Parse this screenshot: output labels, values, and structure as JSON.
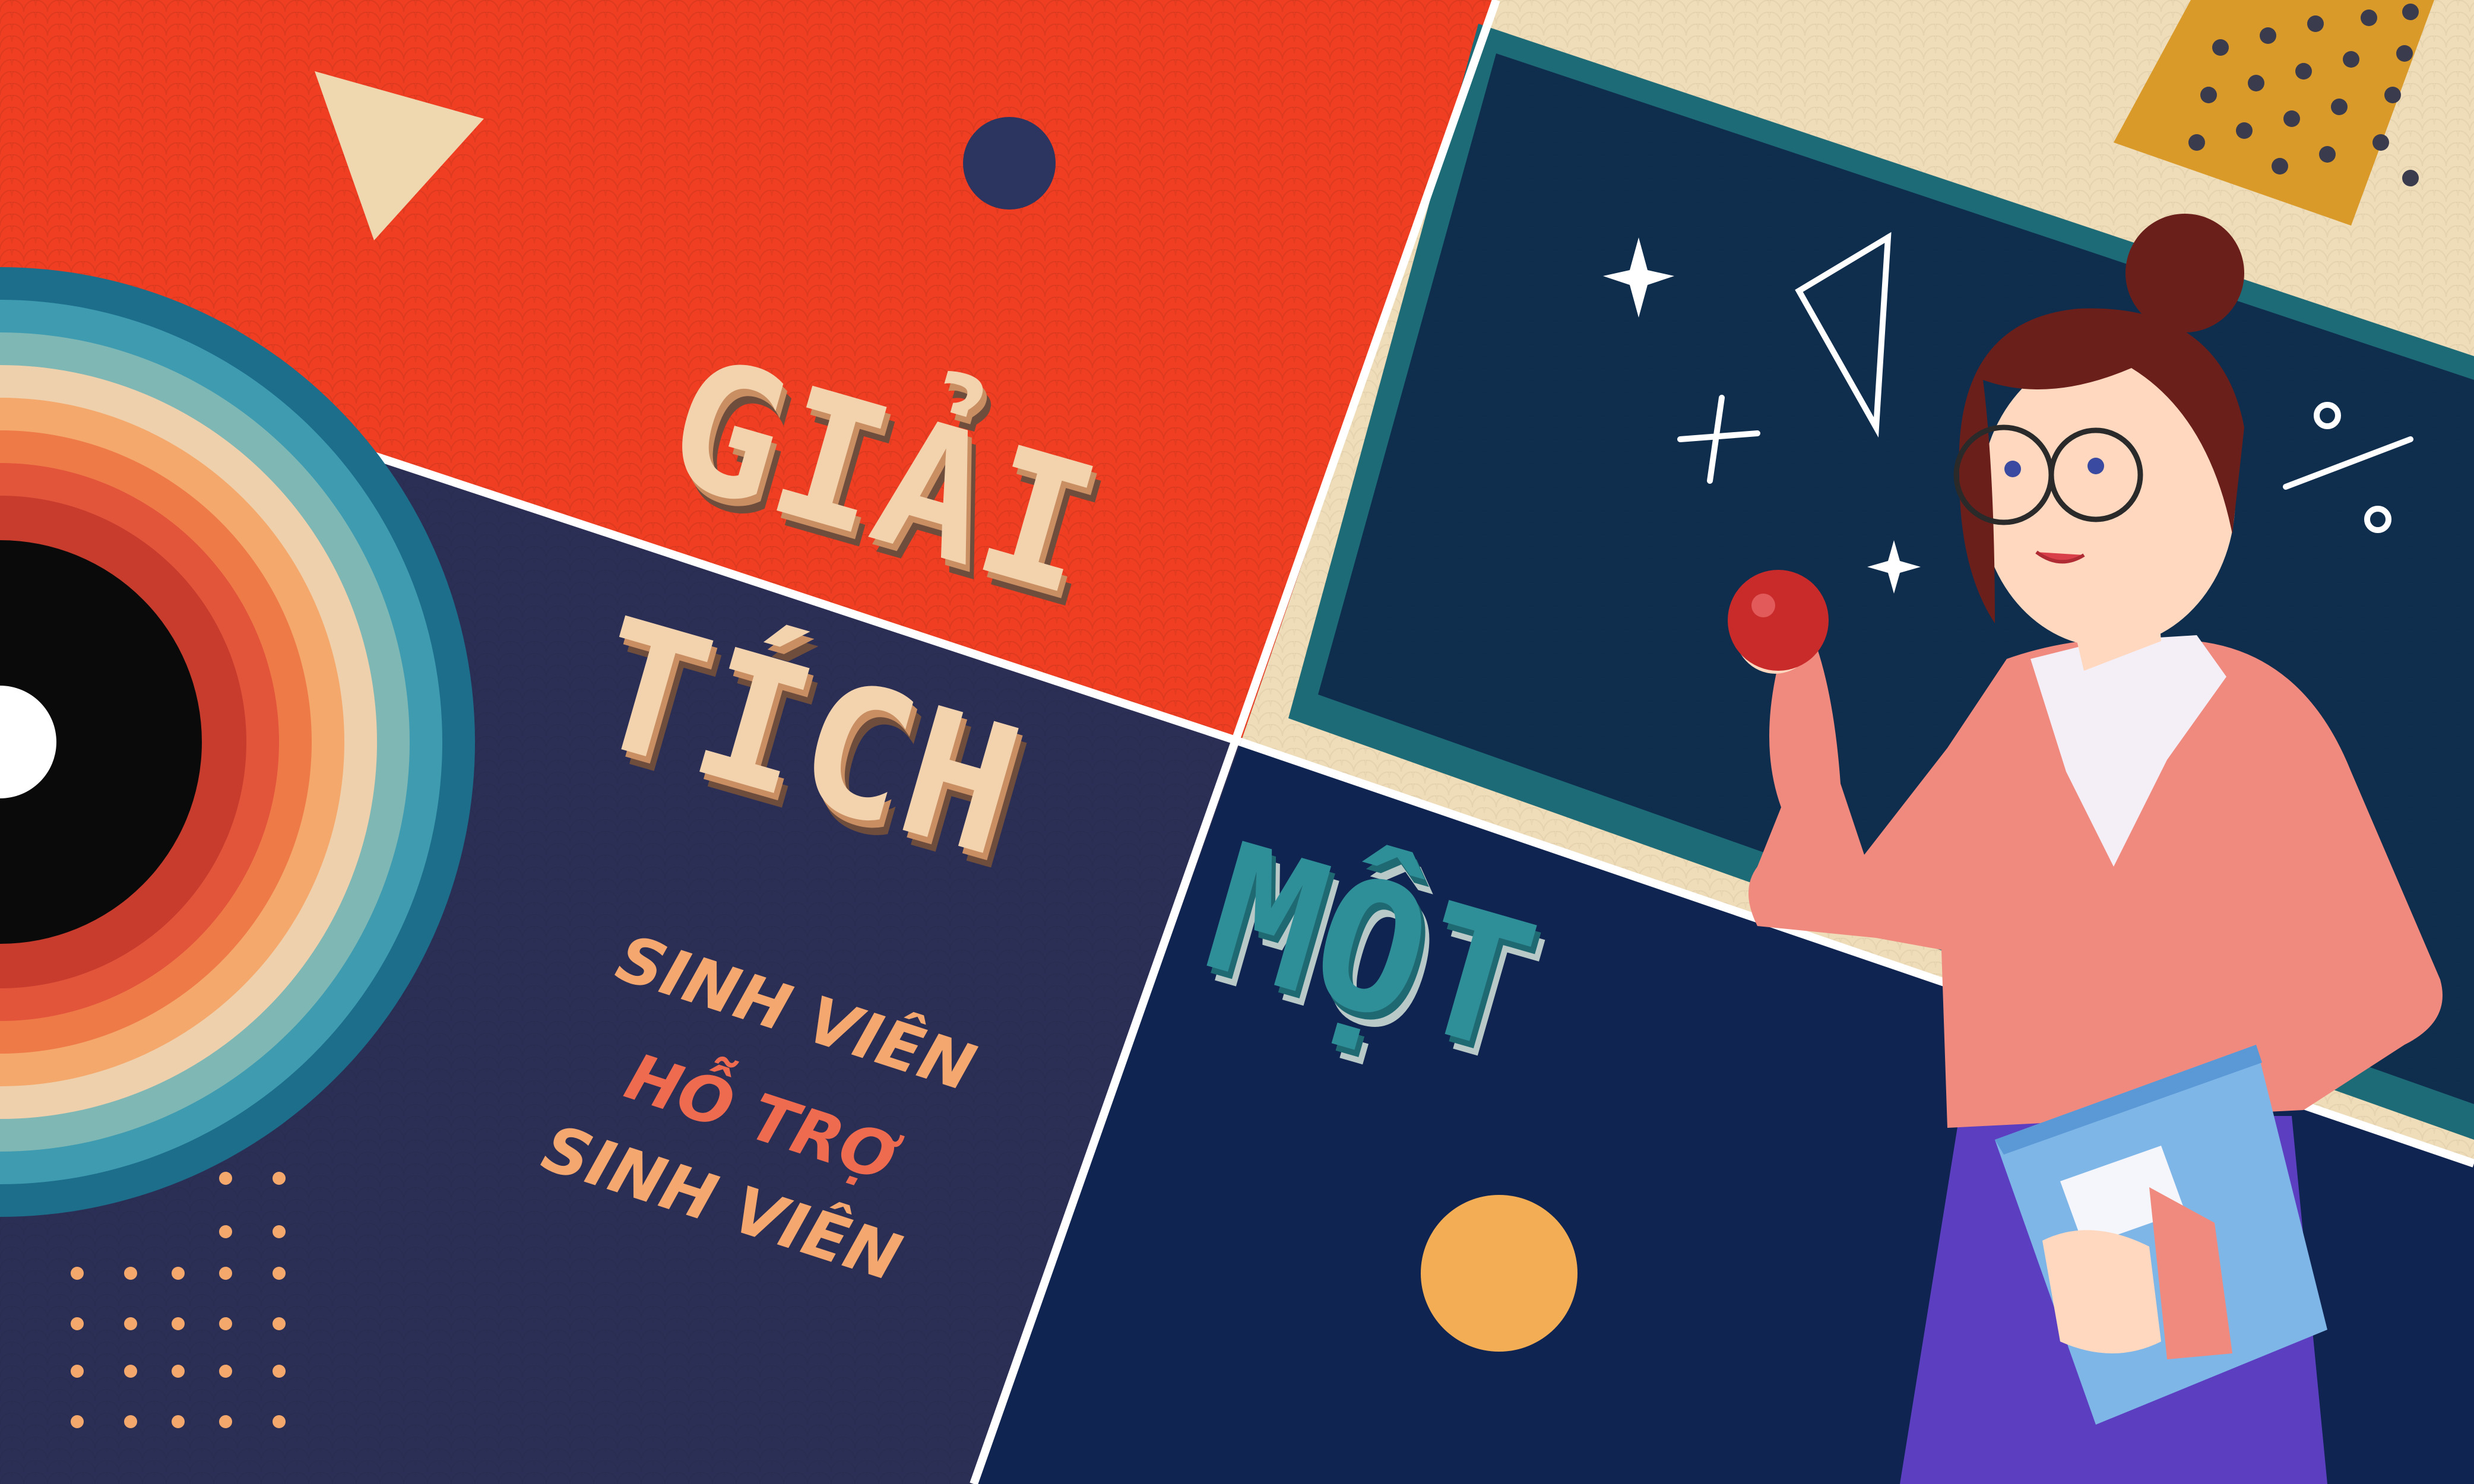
{
  "banner": {
    "title_word_1": "GIẢI",
    "title_word_2": "TÍCH",
    "title_word_3": "MỘT",
    "slogan_line_1": "SINH VIÊN",
    "slogan_line_2": "HỖ TRỢ",
    "slogan_line_3": "SINH VIÊN"
  },
  "colors": {
    "red_panel": "#ef3e22",
    "navy_panel": "#2c2f55",
    "deep_navy": "#0f2450",
    "cream": "#f2d3ae",
    "teal_title": "#2f8f98",
    "slogan_orange": "#f4a76e",
    "slogan_red": "#ee6b4f",
    "blouse_pink": "#f08a7e",
    "skirt_purple": "#5b3fc0"
  }
}
